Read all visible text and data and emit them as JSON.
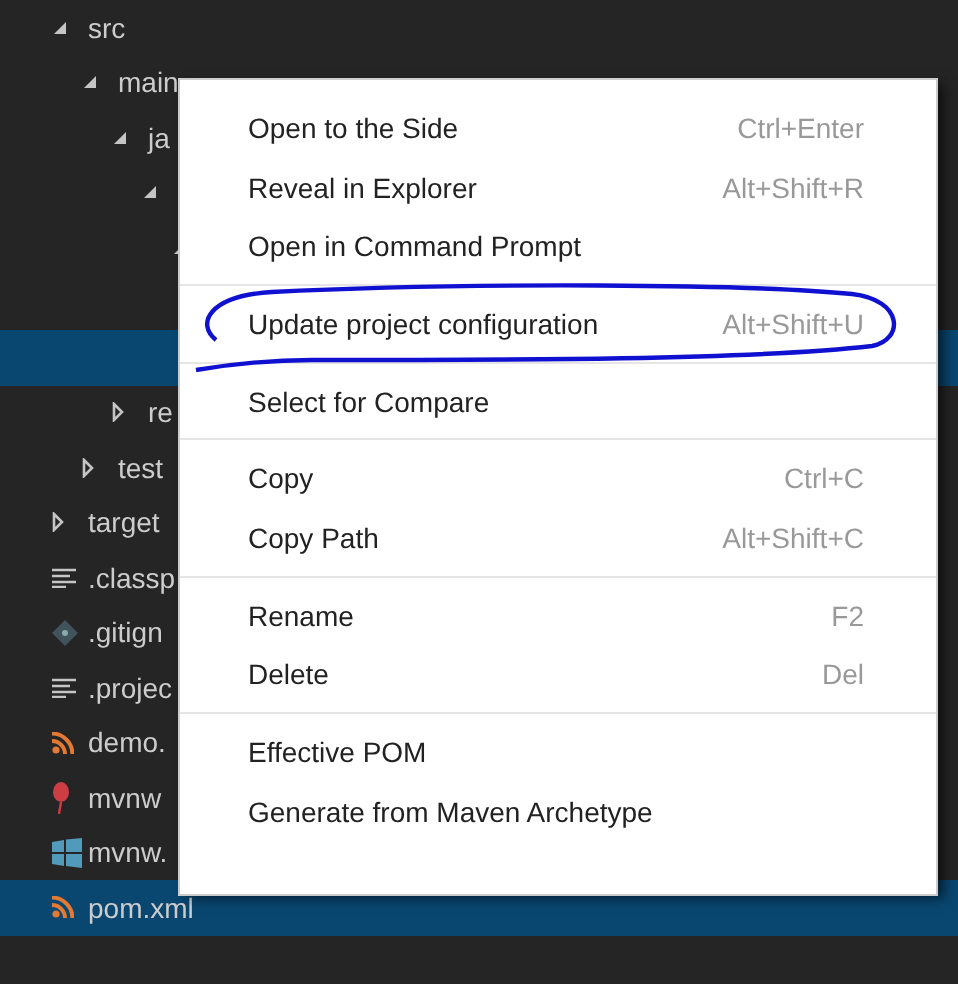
{
  "tree": [
    {
      "kind": "folder",
      "name": "src",
      "expanded": true,
      "selected": false,
      "children": [
        {
          "kind": "folder",
          "name": "main",
          "expanded": true,
          "selected": false,
          "children": [
            {
              "kind": "folder",
              "name": "ja",
              "expanded": true,
              "selected": false,
              "children": [
                {
                  "kind": "folder",
                  "expanded": true,
                  "selected": false,
                  "children": [
                    {
                      "kind": "folder",
                      "expanded": true,
                      "selected": false,
                      "children": [
                        {
                          "selected": false
                        },
                        {
                          "selected": true
                        }
                      ]
                    }
                  ]
                }
              ]
            },
            {
              "kind": "folder",
              "name": "re",
              "expanded": false,
              "selected": false
            }
          ]
        },
        {
          "kind": "folder",
          "name": "test",
          "expanded": false,
          "selected": false
        }
      ]
    },
    {
      "kind": "folder",
      "name": "target",
      "expanded": false,
      "selected": false
    },
    {
      "kind": "text",
      "name": ".classp",
      "selected": false
    },
    {
      "kind": "git",
      "name": ".gitign",
      "selected": false
    },
    {
      "kind": "text",
      "name": ".projec",
      "selected": false
    },
    {
      "kind": "xml",
      "name": "demo.",
      "selected": false
    },
    {
      "kind": "shell",
      "name": "mvnw",
      "selected": false
    },
    {
      "kind": "windows",
      "name": "mvnw.",
      "selected": false
    },
    {
      "kind": "xml",
      "name": "pom.xml",
      "selected": true
    }
  ],
  "menu": [
    [
      {
        "label": "Open to the Side",
        "shortcut": "Ctrl+Enter"
      },
      {
        "label": "Reveal in Explorer",
        "shortcut": "Alt+Shift+R"
      },
      {
        "label": "Open in Command Prompt"
      }
    ],
    [
      {
        "label": "Update project configuration",
        "shortcut": "Alt+Shift+U"
      }
    ],
    [
      {
        "label": "Select for Compare"
      }
    ],
    [
      {
        "label": "Copy",
        "shortcut": "Ctrl+C"
      },
      {
        "label": "Copy Path",
        "shortcut": "Alt+Shift+C"
      }
    ],
    [
      {
        "label": "Rename",
        "shortcut": "F2"
      },
      {
        "label": "Delete",
        "shortcut": "Del"
      }
    ],
    [
      {
        "label": "Effective POM"
      },
      {
        "label": "Generate from Maven Archetype"
      }
    ]
  ]
}
